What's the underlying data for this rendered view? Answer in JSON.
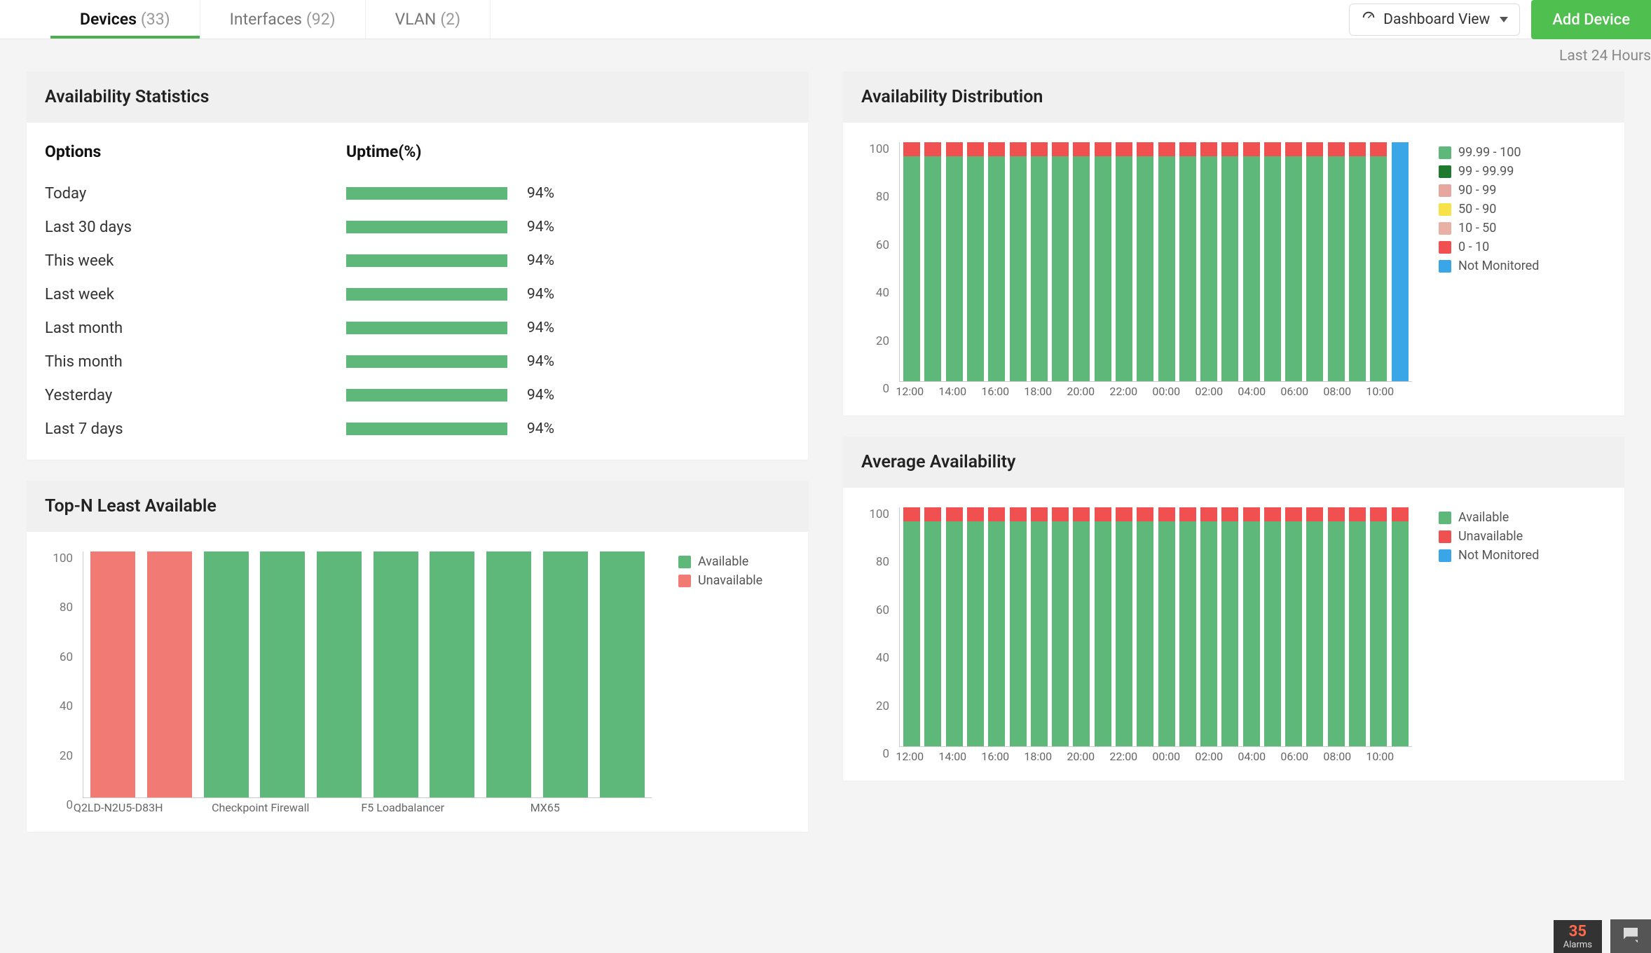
{
  "tabs": [
    {
      "label": "Devices",
      "count": "(33)",
      "active": true
    },
    {
      "label": "Interfaces",
      "count": "(92)",
      "active": false
    },
    {
      "label": "VLAN",
      "count": "(2)",
      "active": false
    }
  ],
  "actions": {
    "dashboard_view": "Dashboard View",
    "add_device": "Add Device"
  },
  "time_range": "Last 24 Hours",
  "cards": {
    "availability_statistics": "Availability Statistics",
    "availability_distribution": "Availability Distribution",
    "top_n_least": "Top-N Least Available",
    "average_availability": "Average Availability"
  },
  "stats_headers": {
    "options": "Options",
    "uptime": "Uptime(%)"
  },
  "stats_rows": [
    {
      "label": "Today",
      "pct": "94%"
    },
    {
      "label": "Last 30 days",
      "pct": "94%"
    },
    {
      "label": "This week",
      "pct": "94%"
    },
    {
      "label": "Last week",
      "pct": "94%"
    },
    {
      "label": "Last month",
      "pct": "94%"
    },
    {
      "label": "This month",
      "pct": "94%"
    },
    {
      "label": "Yesterday",
      "pct": "94%"
    },
    {
      "label": "Last 7 days",
      "pct": "94%"
    }
  ],
  "alarms": {
    "count": "35",
    "label": "Alarms"
  },
  "chart_data": [
    {
      "id": "top_n_least",
      "type": "bar",
      "title": "Top-N Least Available",
      "ylabel": "",
      "xlabel": "",
      "ylim": [
        0,
        100
      ],
      "y_ticks": [
        0,
        20,
        40,
        60,
        80,
        100
      ],
      "categories": [
        "Q2LD-N2U5-D83H",
        "",
        "Checkpoint Firewall",
        "",
        "F5 Loadbalancer",
        "",
        "MX65",
        ""
      ],
      "series": [
        {
          "name": "Available",
          "color": "#5db87a",
          "values": [
            0,
            0,
            100,
            100,
            100,
            100,
            100,
            100,
            100,
            100
          ]
        },
        {
          "name": "Unavailable",
          "color": "#f17a74",
          "values": [
            100,
            100,
            0,
            0,
            0,
            0,
            0,
            0,
            0,
            0
          ]
        }
      ],
      "legend": [
        {
          "label": "Available",
          "color": "#5db87a"
        },
        {
          "label": "Unavailable",
          "color": "#f17a74"
        }
      ]
    },
    {
      "id": "availability_distribution",
      "type": "bar",
      "title": "Availability Distribution",
      "ylim": [
        0,
        100
      ],
      "y_ticks": [
        0,
        20,
        40,
        60,
        80,
        100
      ],
      "x_ticks": [
        "12:00",
        "14:00",
        "16:00",
        "18:00",
        "20:00",
        "22:00",
        "00:00",
        "02:00",
        "04:00",
        "06:00",
        "08:00",
        "10:00"
      ],
      "n_bars": 24,
      "series": [
        {
          "name": "99.99 - 100",
          "color": "#5db87a",
          "values_default": 94
        },
        {
          "name": "0 - 10",
          "color": "#f05050",
          "values_default": 6
        }
      ],
      "special_bars": {
        "23": {
          "Not Monitored": 100
        }
      },
      "legend": [
        {
          "label": "99.99 - 100",
          "color": "#5db87a"
        },
        {
          "label": "99 - 99.99",
          "color": "#1f7a2f"
        },
        {
          "label": "90 - 99",
          "color": "#e7a7a0"
        },
        {
          "label": "50 - 90",
          "color": "#f8e24a"
        },
        {
          "label": "10 - 50",
          "color": "#e9b0a4"
        },
        {
          "label": "0 - 10",
          "color": "#f05050"
        },
        {
          "label": "Not Monitored",
          "color": "#3aa6e8"
        }
      ]
    },
    {
      "id": "average_availability",
      "type": "bar",
      "title": "Average Availability",
      "ylim": [
        0,
        100
      ],
      "y_ticks": [
        0,
        20,
        40,
        60,
        80,
        100
      ],
      "x_ticks": [
        "12:00",
        "14:00",
        "16:00",
        "18:00",
        "20:00",
        "22:00",
        "00:00",
        "02:00",
        "04:00",
        "06:00",
        "08:00",
        "10:00"
      ],
      "n_bars": 24,
      "series": [
        {
          "name": "Available",
          "color": "#5db87a",
          "values_default": 94
        },
        {
          "name": "Unavailable",
          "color": "#f05050",
          "values_default": 6
        }
      ],
      "legend": [
        {
          "label": "Available",
          "color": "#5db87a"
        },
        {
          "label": "Unavailable",
          "color": "#f05050"
        },
        {
          "label": "Not Monitored",
          "color": "#3aa6e8"
        }
      ]
    }
  ]
}
